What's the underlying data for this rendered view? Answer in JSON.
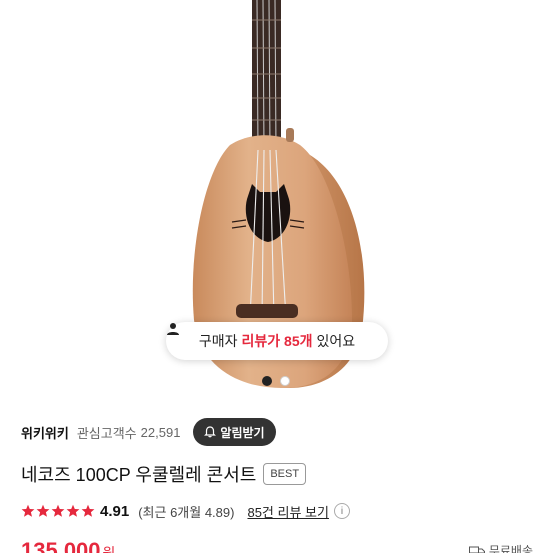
{
  "review_pill": {
    "prefix": "구매자",
    "highlight": "리뷰가 85개",
    "suffix": "있어요"
  },
  "carousel": {
    "total": 2,
    "active_index": 0
  },
  "seller": {
    "name": "위키위키",
    "interest_label": "관심고객수",
    "interest_count": "22,591",
    "alert_button": "알림받기"
  },
  "product": {
    "title": "네코즈 100CP 우쿨렐레 콘서트",
    "badge": "BEST"
  },
  "rating": {
    "value": "4.91",
    "stars": 5,
    "recent": "(최근 6개월 4.89)",
    "review_link": "85건 리뷰 보기",
    "info_icon": "i"
  },
  "price": {
    "amount": "135,000",
    "unit": "원"
  },
  "shipping": {
    "label": "무료배송"
  },
  "colors": {
    "accent_red": "#e5283d",
    "star_red": "#e5283d",
    "dark_button": "#333333",
    "wood": "#d9a57c"
  }
}
